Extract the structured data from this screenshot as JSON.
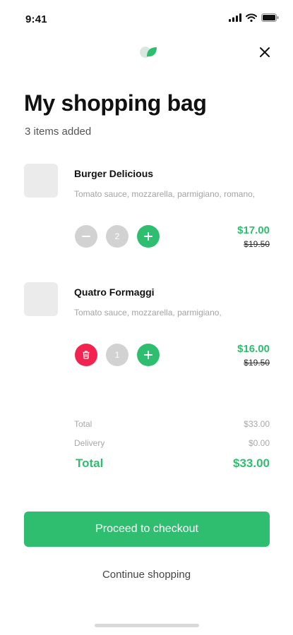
{
  "status_bar": {
    "time": "9:41"
  },
  "header": {
    "logo_icon": "leaf-logo-icon",
    "close_icon": "close-icon"
  },
  "page": {
    "title": "My shopping bag",
    "subtitle": "3 items added"
  },
  "items": [
    {
      "name": "Burger Delicious",
      "description": "Tomato sauce, mozzarella, parmigiano, romano,",
      "quantity": "2",
      "price": "$17.00",
      "old_price": "$19.50",
      "decrement_icon": "minus-icon",
      "increment_icon": "plus-icon"
    },
    {
      "name": "Quatro Formaggi",
      "description": "Tomato sauce, mozzarella, parmigiano,",
      "quantity": "1",
      "price": "$16.00",
      "old_price": "$19.50",
      "decrement_icon": "trash-icon",
      "increment_icon": "plus-icon"
    }
  ],
  "summary": {
    "subtotal_label": "Total",
    "subtotal_value": "$33.00",
    "delivery_label": "Delivery",
    "delivery_value": "$0.00",
    "total_label": "Total",
    "total_value": "$33.00"
  },
  "actions": {
    "checkout_label": "Proceed to checkout",
    "continue_label": "Continue shopping"
  },
  "colors": {
    "accent": "#2fbe6f",
    "danger": "#f2244f",
    "muted_button": "#d2d2d2",
    "thumbnail": "#ebebeb"
  }
}
